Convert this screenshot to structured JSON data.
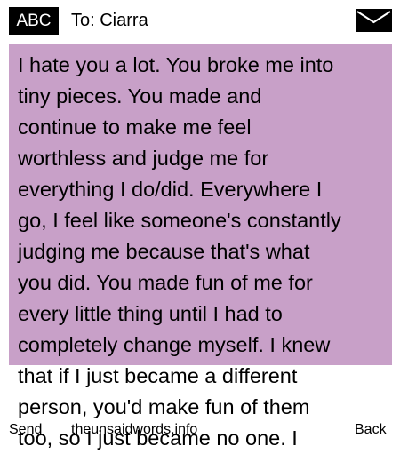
{
  "header": {
    "input_mode": "ABC",
    "recipient_label": "To: Ciarra",
    "icon": "envelope-icon"
  },
  "message": {
    "text": "I hate you a lot. You broke me into\ntiny pieces. You made and\ncontinue to make me feel\nworthless and judge me for\neverything I do/did. Everywhere I\ngo, I feel like someone's constantly\njudging me because that's what\nyou did. You made fun of me for\nevery little thing until I had to\ncompletely change myself. I knew\nthat if I just became a different\nperson, you'd make fun of them\ntoo, so I just became no one. I",
    "bubble_color": "#c8a0c8"
  },
  "softkeys": {
    "left": "Send",
    "center": "theunsaidwords.info",
    "right": "Back"
  }
}
